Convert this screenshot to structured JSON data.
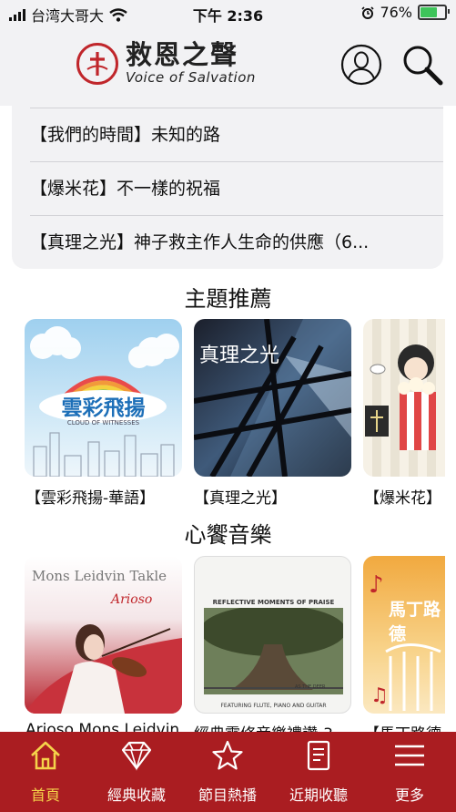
{
  "status_bar": {
    "carrier": "台湾大哥大",
    "time": "下午 2:36",
    "battery": "76%",
    "battery_level": 0.76
  },
  "header": {
    "title_cn": "救恩之聲",
    "title_en": "Voice of Salvation"
  },
  "dropdown": [
    "【我們的時間】未知的路",
    "【爆米花】不一樣的祝福",
    "【真理之光】神子救主作人生命的供應（6..."
  ],
  "sections": {
    "topics": {
      "title": "主題推薦",
      "items": [
        {
          "label": "【雲彩飛揚-華語】",
          "art_title": "雲彩飛揚",
          "art_sub": "CLOUD OF WITNESSES"
        },
        {
          "label": "【真理之光】",
          "art_title": "真理之光",
          "art_sub": ""
        },
        {
          "label": "【爆米花】",
          "art_title": "",
          "art_sub": ""
        }
      ]
    },
    "music": {
      "title": "心饗音樂",
      "items": [
        {
          "label": "Arioso Mons Leidvin",
          "art_title": "Mons Leidvin Takle",
          "art_sub": "Arioso"
        },
        {
          "label": "經典靈修音樂禮讚-3",
          "art_title": "REFLECTIVE MOMENTS OF PRAISE",
          "art_sub": "FEATURING FLUTE, PIANO AND GUITAR",
          "art_mid": "AS THE DEER"
        },
        {
          "label": "【馬丁路德",
          "art_title": "馬丁路德",
          "art_sub": ""
        }
      ]
    }
  },
  "tabs": [
    {
      "label": "首頁",
      "icon": "home-icon",
      "active": true
    },
    {
      "label": "經典收藏",
      "icon": "diamond-icon",
      "active": false
    },
    {
      "label": "節目熱播",
      "icon": "star-icon",
      "active": false
    },
    {
      "label": "近期收聽",
      "icon": "document-icon",
      "active": false
    },
    {
      "label": "更多",
      "icon": "menu-icon",
      "active": false
    }
  ],
  "colors": {
    "brand_red": "#aa1d21",
    "active_tab": "#f5d34a",
    "header_bg": "#f2f2f4"
  }
}
